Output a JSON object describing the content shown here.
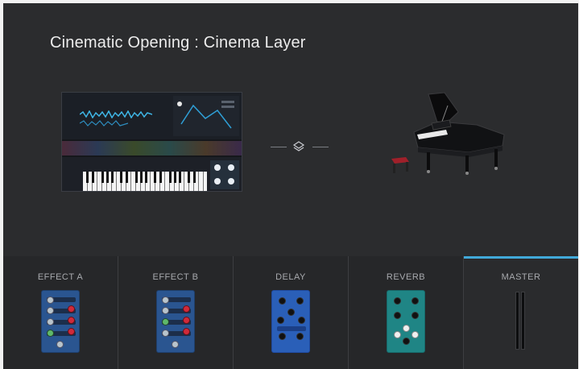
{
  "window": {
    "title": "Cinematic Opening : Cinema Layer"
  },
  "layers": [
    {
      "type": "synth",
      "icon": "synth-thumbnail"
    },
    {
      "type": "piano",
      "icon": "grand-piano-image"
    }
  ],
  "link": {
    "icon": "layers-icon"
  },
  "slots": [
    {
      "label": "EFFECT A",
      "icon": "effect-pedal-icon"
    },
    {
      "label": "EFFECT B",
      "icon": "effect-pedal-icon"
    },
    {
      "label": "DELAY",
      "icon": "delay-pedal-icon"
    },
    {
      "label": "REVERB",
      "icon": "reverb-pedal-icon"
    },
    {
      "label": "MASTER",
      "icon": "master-meter-icon",
      "selected": true
    }
  ],
  "colors": {
    "background": "#2b2c2e",
    "accent": "#41a9d9"
  }
}
